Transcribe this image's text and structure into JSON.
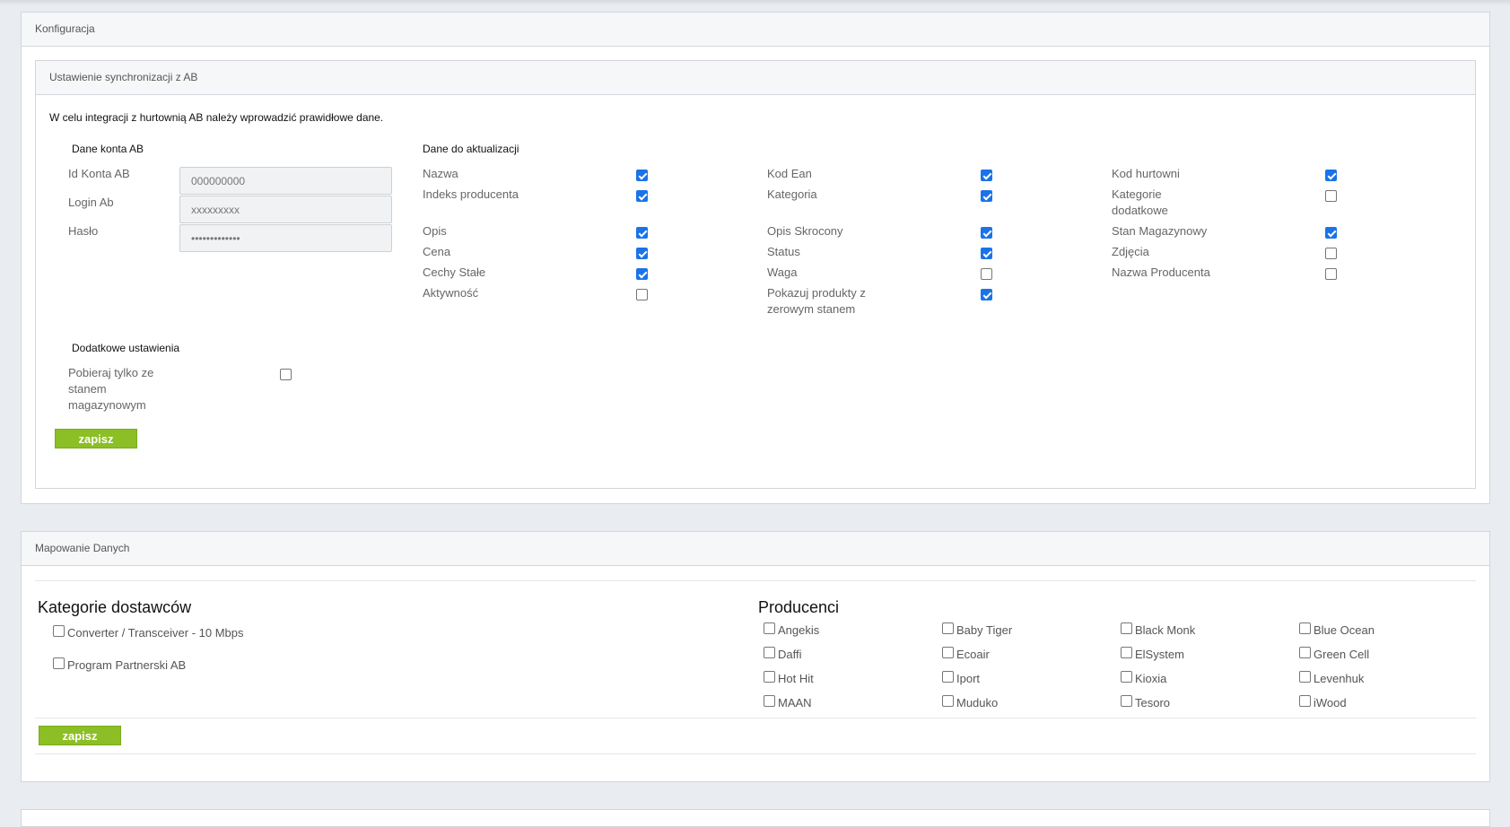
{
  "config": {
    "title": "Konfiguracja",
    "sync": {
      "title": "Ustawienie synchronizacji z AB",
      "intro": "W celu integracji z hurtownią AB należy wprowadzić prawidłowe dane.",
      "account_heading": "Dane konta AB",
      "id_label": "Id Konta AB",
      "id_value": "000000000",
      "login_label": "Login Ab",
      "login_value": "xxxxxxxxx",
      "password_label": "Hasło",
      "password_value": "•••••••••••••",
      "update_heading": "Dane do aktualizacji",
      "fields": [
        {
          "label": "Nazwa",
          "checked": true
        },
        {
          "label": "Kod Ean",
          "checked": true
        },
        {
          "label": "Kod hurtowni",
          "checked": true
        },
        {
          "label": "Indeks producenta",
          "checked": true
        },
        {
          "label": "Kategoria",
          "checked": true
        },
        {
          "label": "Kategorie dodatkowe",
          "checked": false
        },
        {
          "label": "Opis",
          "checked": true
        },
        {
          "label": "Opis Skrocony",
          "checked": true
        },
        {
          "label": "Stan Magazynowy",
          "checked": true
        },
        {
          "label": "Cena",
          "checked": true
        },
        {
          "label": "Status",
          "checked": true
        },
        {
          "label": "Zdjęcia",
          "checked": false
        },
        {
          "label": "Cechy Stałe",
          "checked": true
        },
        {
          "label": "Waga",
          "checked": false
        },
        {
          "label": "Nazwa Producenta",
          "checked": false
        },
        {
          "label": "Aktywność",
          "checked": false
        },
        {
          "label": "Pokazuj produkty z zerowym stanem",
          "checked": true
        }
      ],
      "extra_heading": "Dodatkowe ustawienia",
      "extra_option": {
        "label": "Pobieraj tylko ze stanem magazynowym",
        "checked": false
      },
      "save_label": "zapisz"
    }
  },
  "mapping": {
    "title": "Mapowanie Danych",
    "categories_heading": "Kategorie dostawców",
    "categories": [
      {
        "label": "Converter / Transceiver - 10 Mbps",
        "checked": false
      },
      {
        "label": "Program Partnerski AB",
        "checked": false
      }
    ],
    "producers_heading": "Producenci",
    "producers": [
      {
        "label": "Angekis",
        "checked": false
      },
      {
        "label": "Baby Tiger",
        "checked": false
      },
      {
        "label": "Black Monk",
        "checked": false
      },
      {
        "label": "Blue Ocean",
        "checked": false
      },
      {
        "label": "Daffi",
        "checked": false
      },
      {
        "label": "Ecoair",
        "checked": false
      },
      {
        "label": "ElSystem",
        "checked": false
      },
      {
        "label": "Green Cell",
        "checked": false
      },
      {
        "label": "Hot Hit",
        "checked": false
      },
      {
        "label": "Iport",
        "checked": false
      },
      {
        "label": "Kioxia",
        "checked": false
      },
      {
        "label": "Levenhuk",
        "checked": false
      },
      {
        "label": "MAAN",
        "checked": false
      },
      {
        "label": "Muduko",
        "checked": false
      },
      {
        "label": "Tesoro",
        "checked": false
      },
      {
        "label": "iWood",
        "checked": false
      }
    ],
    "save_label": "zapisz"
  }
}
